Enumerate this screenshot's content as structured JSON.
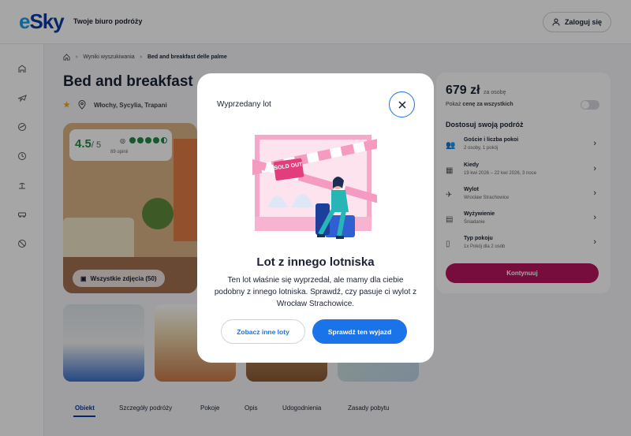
{
  "header": {
    "logo_text": "eSky",
    "tagline": "Twoje biuro podróży",
    "login_label": "Zaloguj się"
  },
  "sidenav": {
    "icons": [
      "hotel-icon",
      "flight-icon",
      "flight-hotel-icon",
      "clock-icon",
      "beach-icon",
      "car-icon",
      "cancel-icon"
    ]
  },
  "breadcrumb": {
    "home_icon": "home-icon",
    "item1": "Wyniki wyszukiwania",
    "item2": "Bed and breakfast delle palme"
  },
  "hotel": {
    "title": "Bed and breakfast delle palme",
    "location": "Włochy, Sycylia, Trapani",
    "rating": "4.5",
    "rating_of": "/ 5",
    "reviews": "89 opinii",
    "all_photos": "Wszystkie zdjęcia (50)"
  },
  "tabs": [
    "Obiekt",
    "Szczegóły podróży",
    "Pokoje",
    "Opis",
    "Udogodnienia",
    "Zasady pobytu"
  ],
  "booking": {
    "price": "679 zł",
    "price_per": "za osobę",
    "price_toggle_prefix": "Pokaż",
    "price_toggle_bold": "cenę za wszystkich",
    "customize_title": "Dostosuj swoją podróż",
    "options": [
      {
        "label": "Goście i liczba pokoi",
        "sub": "2 osoby, 1 pokój",
        "icon": "people-icon"
      },
      {
        "label": "Kiedy",
        "sub": "19 kwi 2026 – 22 kwi 2026, 3 noce",
        "icon": "calendar-icon"
      },
      {
        "label": "Wylot",
        "sub": "Wrocław Strachowice",
        "icon": "departure-icon"
      },
      {
        "label": "Wyżywienie",
        "sub": "Śniadanie",
        "icon": "meal-icon"
      },
      {
        "label": "Typ pokoju",
        "sub": "1x Pokój dla 2 osób",
        "icon": "door-icon"
      }
    ],
    "continue_label": "Kontynuuj"
  },
  "modal": {
    "title": "Wyprzedany lot",
    "sold_out_sign": "SOLD OUT",
    "headline": "Lot z innego lotniska",
    "body": "Ten lot właśnie się wyprzedał, ale mamy dla ciebie podobny z innego lotniska. Sprawdź, czy pasuje ci wylot z Wrocław Strachowice.",
    "secondary_button": "Zobacz inne loty",
    "primary_button": "Sprawdź ten wyjazd"
  }
}
